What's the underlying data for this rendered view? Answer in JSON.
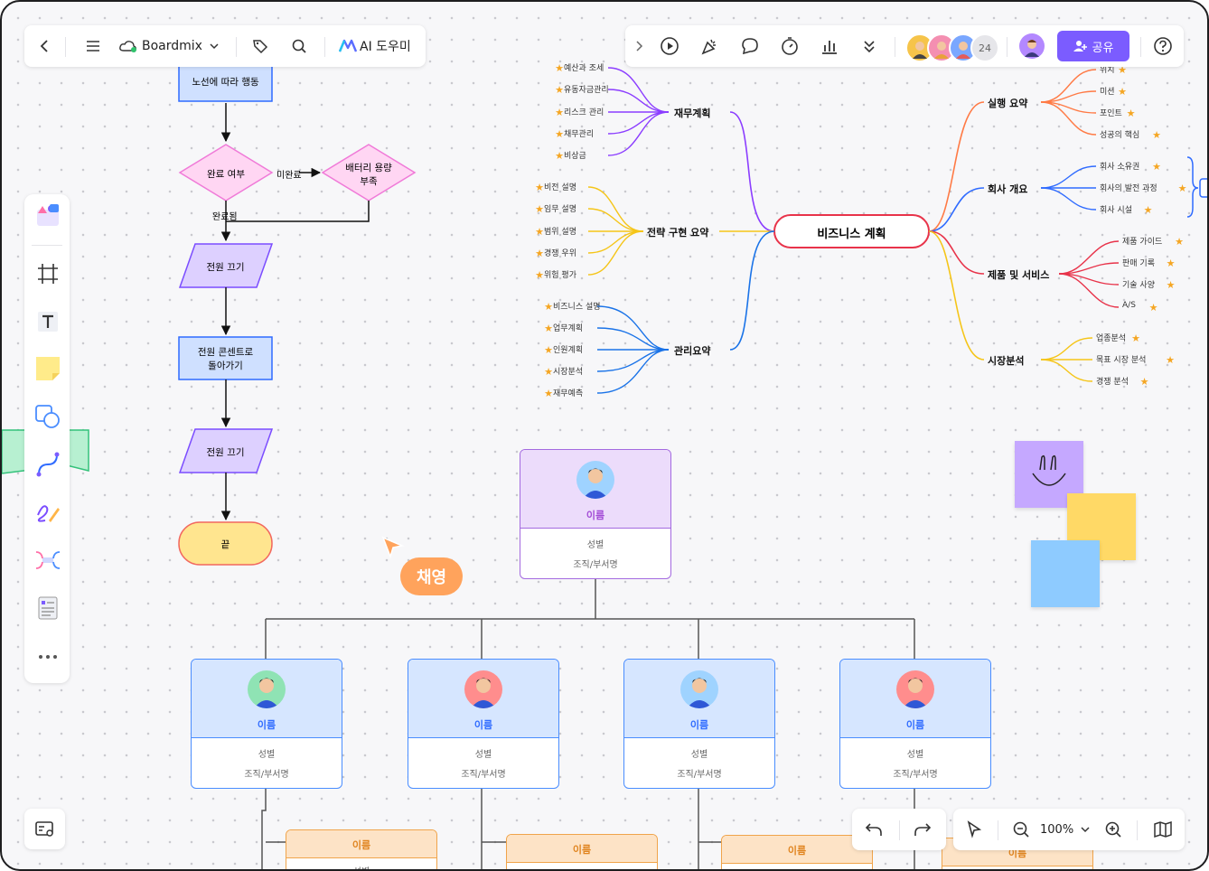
{
  "toolbar_left": {
    "back_icon": "chevron-left-icon",
    "menu_icon": "hamburger-icon",
    "app_name": "Boardmix",
    "tag_icon": "tag-icon",
    "search_icon": "search-icon",
    "ai_label": "AI 도우미"
  },
  "toolbar_right": {
    "collaborator_count": "24",
    "share_label": "공유",
    "help_icon": "help-icon"
  },
  "zoom": {
    "level": "100%"
  },
  "flowchart": {
    "start": "노선에 따라 행동",
    "decision1": "완료 여부",
    "no_label": "미완료",
    "decision2_line1": "배터리 용량",
    "decision2_line2": "부족",
    "yes_label": "완료됨",
    "step1": "전원 끄기",
    "step2_line1": "전원 콘센트로",
    "step2_line2": "돌아가기",
    "step3": "전원 끄기",
    "end": "끝"
  },
  "mindmap": {
    "center": "비즈니스 계획",
    "left": [
      {
        "title": "재무계획",
        "color": "#8b3dff",
        "items": [
          "예산과 조세",
          "유동자금관리",
          "리스크 관리",
          "채무관리",
          "비상금"
        ]
      },
      {
        "title": "전략 구현 요약",
        "color": "#f5c518",
        "items": [
          "비전 설명",
          "임무 설명",
          "범위 설명",
          "경쟁 우위",
          "위험 평가"
        ]
      },
      {
        "title": "관리요약",
        "color": "#1a73e8",
        "items": [
          "비즈니스 설명",
          "업무계획",
          "인원계획",
          "시장분석",
          "재무예측"
        ]
      }
    ],
    "right": [
      {
        "title": "실행 요약",
        "color": "#ff7a45",
        "items": [
          "위치",
          "미션",
          "포인트",
          "성공의 핵심"
        ]
      },
      {
        "title": "회사 개요",
        "color": "#2f6bff",
        "items": [
          "회사 소유권",
          "회사의 발전 과정",
          "회사 시설"
        ]
      },
      {
        "title": "제품 및 서비스",
        "color": "#e8334a",
        "items": [
          "제품 가이드",
          "판매 기록",
          "기술 사양",
          "A/S"
        ]
      },
      {
        "title": "시장분석",
        "color": "#f5c518",
        "items": [
          "업종분석",
          "목표 시장 분석",
          "경쟁 분석"
        ]
      }
    ]
  },
  "cursor_label": "채영",
  "org_chart": {
    "root": {
      "name": "이름",
      "gender": "성별",
      "dept": "조직/부서명"
    },
    "children": [
      {
        "name": "이름",
        "gender": "성별",
        "dept": "조직/부서명"
      },
      {
        "name": "이름",
        "gender": "성별",
        "dept": "조직/부서명"
      },
      {
        "name": "이름",
        "gender": "성별",
        "dept": "조직/부서명"
      },
      {
        "name": "이름",
        "gender": "성별",
        "dept": "조직/부서명"
      }
    ],
    "grandchildren": [
      {
        "name": "이름",
        "gender": "성별"
      },
      {
        "name": "이름"
      },
      {
        "name": "이름"
      },
      {
        "name": "이름"
      }
    ]
  },
  "colors": {
    "accent": "#7b5cff",
    "share": "#7b5cff"
  }
}
